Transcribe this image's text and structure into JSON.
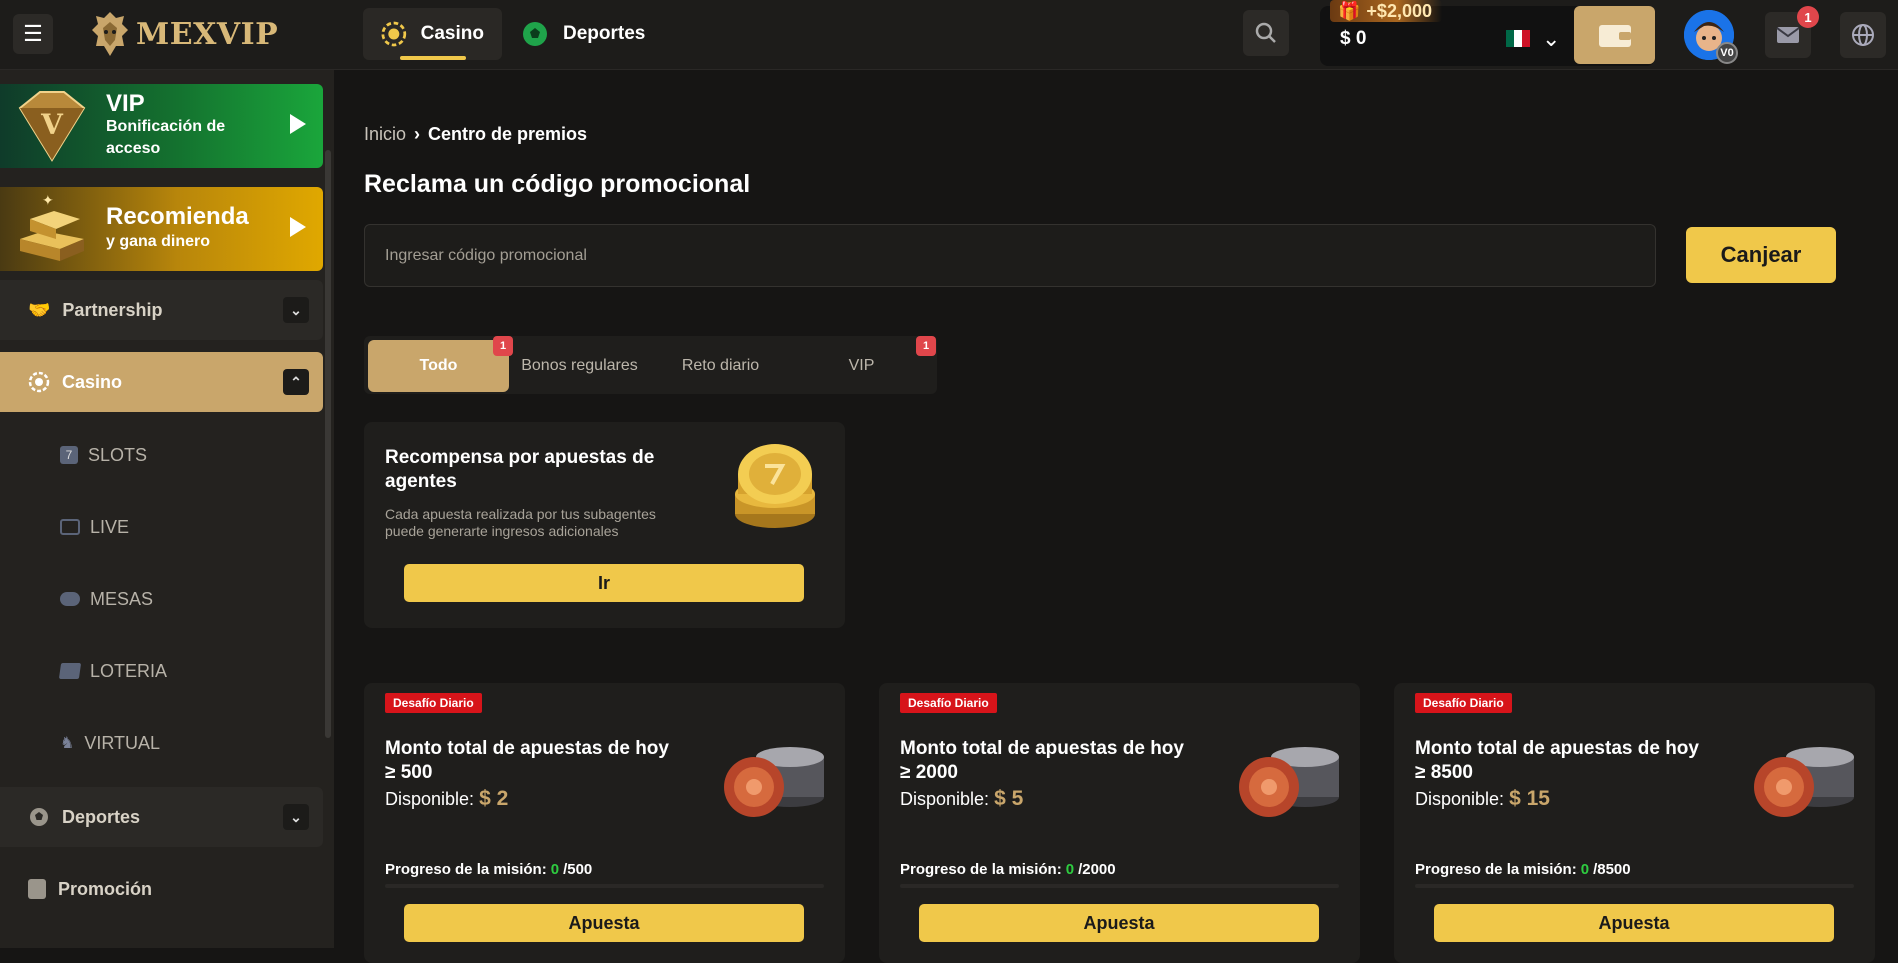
{
  "header": {
    "logo_text": "MEXVIP",
    "nav": [
      {
        "label": "Casino",
        "icon": "casino-chip-icon",
        "active": true
      },
      {
        "label": "Deportes",
        "icon": "soccer-ball-icon",
        "active": false
      }
    ],
    "wallet": {
      "bonus": "+$2,000",
      "balance": "$ 0",
      "country_flag": "mexico-flag-icon"
    },
    "mail_count": "1",
    "avatar_badge": "V0"
  },
  "sidebar": {
    "promos": [
      {
        "title": "VIP",
        "subtitle_line1": "Bonificación de",
        "subtitle_line2": "acceso"
      },
      {
        "title": "Recomienda",
        "subtitle": "y gana dinero"
      }
    ],
    "items": [
      {
        "label": "Partnership",
        "icon": "handshake-icon",
        "expanded": false
      },
      {
        "label": "Casino",
        "icon": "casino-chip-icon",
        "expanded": true
      },
      {
        "label": "Deportes",
        "icon": "soccer-ball-icon",
        "expanded": false
      },
      {
        "label": "Promoción",
        "icon": "gift-bag-icon"
      }
    ],
    "casino_sub": [
      {
        "label": "SLOTS",
        "icon": "slots-icon"
      },
      {
        "label": "LIVE",
        "icon": "live-tv-icon"
      },
      {
        "label": "MESAS",
        "icon": "gamepad-icon"
      },
      {
        "label": "LOTERIA",
        "icon": "lottery-ticket-icon"
      },
      {
        "label": "VIRTUAL",
        "icon": "horse-icon"
      }
    ]
  },
  "breadcrumb": {
    "home": "Inicio",
    "current": "Centro de premios"
  },
  "page_title": "Reclama un código promocional",
  "promo_code": {
    "placeholder": "Ingresar código promocional",
    "value": "",
    "button": "Canjear"
  },
  "tabs": [
    {
      "label": "Todo",
      "badge": "1",
      "active": true
    },
    {
      "label": "Bonos regulares",
      "badge": ""
    },
    {
      "label": "Reto diario",
      "badge": ""
    },
    {
      "label": "VIP",
      "badge": "1"
    }
  ],
  "agent_card": {
    "title": "Recompensa por apuestas de agentes",
    "description": "Cada apuesta realizada por tus subagentes puede generarte ingresos adicionales",
    "button": "Ir"
  },
  "challenges": [
    {
      "tag": "Desafío Diario",
      "title_line1": "Monto total de apuestas de hoy",
      "title_line2": "≥ 500",
      "available_label": "Disponible:",
      "amount": "$ 2",
      "progress_label": "Progreso de la misión:",
      "progress_current": "0",
      "progress_target": "/500",
      "progress_fraction": 0,
      "button": "Apuesta"
    },
    {
      "tag": "Desafío Diario",
      "title_line1": "Monto total de apuestas de hoy",
      "title_line2": "≥ 2000",
      "available_label": "Disponible:",
      "amount": "$ 5",
      "progress_label": "Progreso de la misión:",
      "progress_current": "0",
      "progress_target": "/2000",
      "progress_fraction": 0,
      "button": "Apuesta"
    },
    {
      "tag": "Desafío Diario",
      "title_line1": "Monto total de apuestas de hoy",
      "title_line2": "≥ 8500",
      "available_label": "Disponible:",
      "amount": "$ 15",
      "progress_label": "Progreso de la misión:",
      "progress_current": "0",
      "progress_target": "/8500",
      "progress_fraction": 0,
      "button": "Apuesta"
    }
  ],
  "colors": {
    "accent_gold": "#f0c84a",
    "tan": "#c9a66b",
    "badge_red": "#e0464b",
    "tag_red": "#d7141a",
    "progress_green": "#2ecc40"
  }
}
